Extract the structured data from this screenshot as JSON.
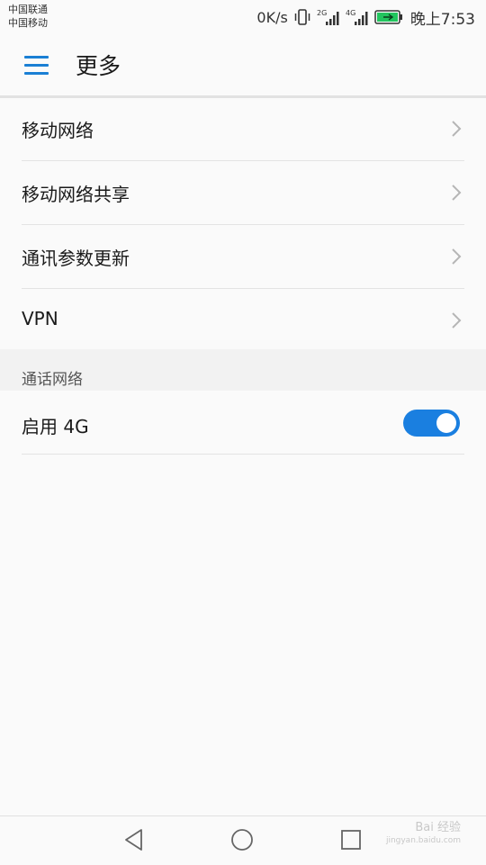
{
  "status_bar": {
    "carrier1": "中国联通",
    "carrier2": "中国移动",
    "net_speed": "0K/s",
    "sim1_type": "2G",
    "sim2_type": "4G",
    "time": "晚上7:53",
    "battery_color": "#22c55e",
    "icons": [
      "vibrate-icon",
      "signal-2g-icon",
      "signal-4g-icon",
      "battery-charging-icon"
    ]
  },
  "app_bar": {
    "title": "更多",
    "menu_icon": "hamburger-menu-icon",
    "accent_color": "#1a7fd4"
  },
  "menu_items": [
    {
      "label": "移动网络",
      "icon": "chevron-right-icon"
    },
    {
      "label": "移动网络共享",
      "icon": "chevron-right-icon"
    },
    {
      "label": "通讯参数更新",
      "icon": "chevron-right-icon"
    },
    {
      "label": "VPN",
      "icon": "chevron-right-icon"
    }
  ],
  "section": {
    "title": "通话网络"
  },
  "toggle": {
    "label": "启用 4G",
    "enabled": true,
    "on_color": "#1a7fe0"
  },
  "nav_bar": {
    "icons": [
      "back-triangle-icon",
      "home-circle-icon",
      "recents-square-icon"
    ]
  },
  "watermark": {
    "text": "Bai 经验",
    "sub": "jingyan.baidu.com"
  }
}
